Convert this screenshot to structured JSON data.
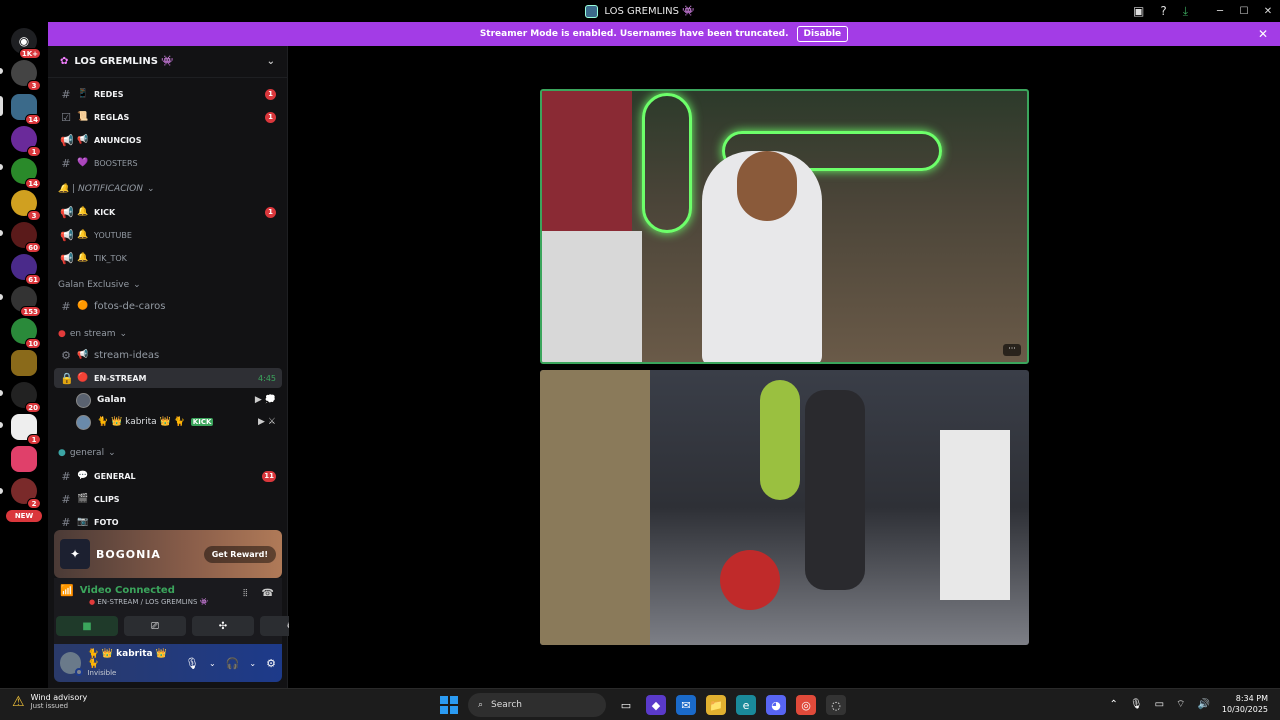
{
  "window": {
    "title": "LOS GREMLINS 👾",
    "controls": [
      "─",
      "☐",
      "✕"
    ]
  },
  "banner": {
    "text": "Streamer Mode is enabled. Usernames have been truncated.",
    "button": "Disable"
  },
  "rail": {
    "badges": [
      "1K+",
      "3",
      "14",
      "1",
      "14",
      "3",
      "60",
      "61",
      "153",
      "10",
      "20",
      "1",
      "2"
    ],
    "new_label": "NEW"
  },
  "server": {
    "name": "LOS GREMLINS 👾",
    "categories": {
      "notificacion": "🔔 | NOTIFICACION",
      "galan": "Galan Exclusive",
      "stream": "en stream",
      "general": "general"
    },
    "channels": {
      "redes": {
        "name": "REDES",
        "emoji": "📱",
        "count": "1"
      },
      "reglas": {
        "name": "REGLAS",
        "emoji": "📜",
        "count": "1"
      },
      "anuncios": {
        "name": "ANUNCIOS",
        "emoji": "📢"
      },
      "boosters": {
        "name": "BOOSTERS",
        "emoji": "💜"
      },
      "kick": {
        "name": "KICK",
        "emoji": "🔔",
        "count": "1"
      },
      "youtube": {
        "name": "YOUTUBE",
        "emoji": "🔔"
      },
      "tiktok": {
        "name": "TIK_TOK",
        "emoji": "🔔"
      },
      "fotos": {
        "name": "fotos-de-caros",
        "emoji": "🟠"
      },
      "ideas": {
        "name": "stream-ideas",
        "emoji": "📢"
      },
      "enstream": {
        "name": "EN-STREAM",
        "emoji": "🔴",
        "timer": "4:45"
      },
      "general": {
        "name": "GENERAL",
        "emoji": "💬",
        "count": "11"
      },
      "clips": {
        "name": "CLIPS",
        "emoji": "🎬"
      },
      "foto": {
        "name": "FOTO",
        "emoji": "📷"
      }
    },
    "voice_users": [
      {
        "name": "Galan"
      },
      {
        "name": "🐈 👑 kabrita 👑 🐈",
        "tag": "KICK"
      }
    ]
  },
  "promo": {
    "name": "BOGONIA",
    "button": "Get Reward!"
  },
  "voice_panel": {
    "status": "Video Connected",
    "location": "EN-STREAM / LOS GREMLINS 👾"
  },
  "user": {
    "name": "🐈 👑 kabrita 👑 🐈",
    "status": "Invisible"
  },
  "taskbar": {
    "weather_title": "Wind advisory",
    "weather_sub": "Just issued",
    "search_placeholder": "Search",
    "time": "8:34 PM",
    "date": "10/30/2025"
  }
}
